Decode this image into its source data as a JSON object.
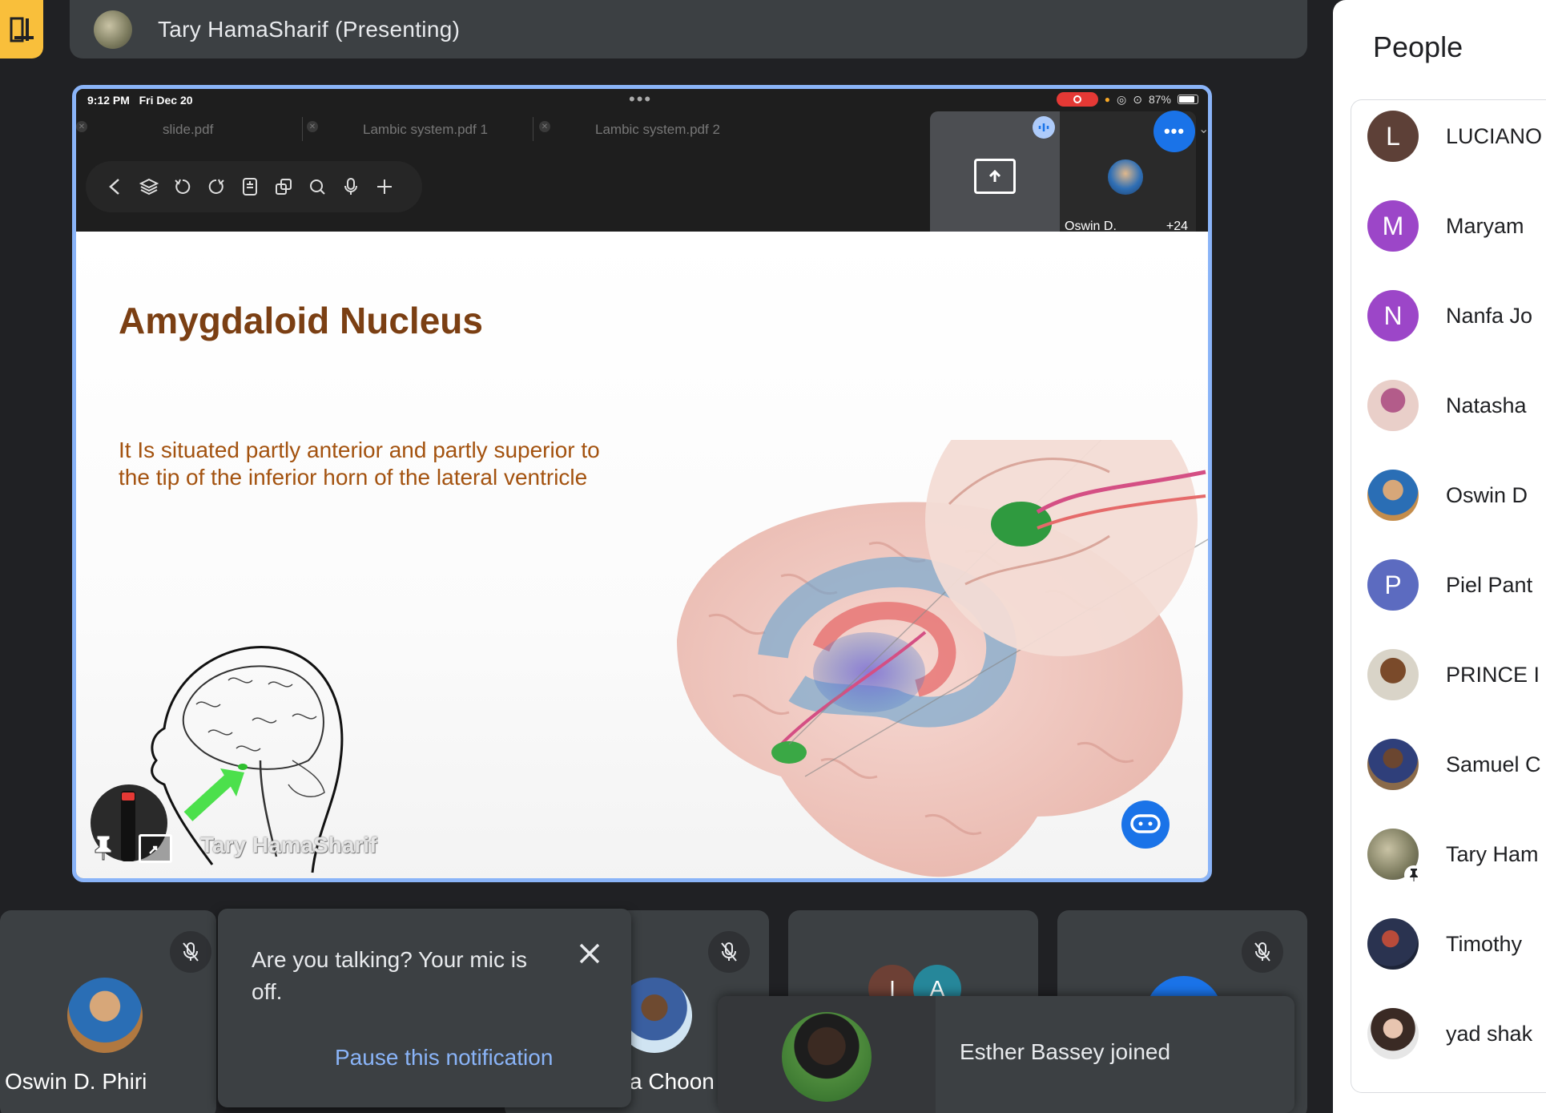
{
  "header": {
    "presenter_title": "Tary HamaSharif (Presenting)"
  },
  "ipad": {
    "time": "9:12 PM",
    "date": "Fri Dec 20",
    "battery": "87%",
    "tabs": [
      {
        "label": "slide.pdf"
      },
      {
        "label": "Lambic system.pdf 1"
      },
      {
        "label": "Lambic system.pdf 2"
      }
    ],
    "mini_tile": {
      "name": "Oswin D.",
      "count": "+24"
    }
  },
  "slide": {
    "title": "Amygdaloid Nucleus",
    "body": "It Is situated partly anterior and partly superior to the tip of the inferior horn of the lateral ventricle",
    "presenter_label": "Tary HamaSharif"
  },
  "tiles": [
    {
      "name": "Oswin D. Phiri"
    },
    {
      "name": "a Choon"
    },
    {
      "initials": [
        "I",
        "A"
      ]
    }
  ],
  "notification": {
    "text": "Are you talking? Your mic is off.",
    "action": "Pause this notification"
  },
  "join_toast": {
    "text": "Esther Bassey joined"
  },
  "people": {
    "title": "People",
    "list": [
      {
        "initial": "L",
        "name": "LUCIANO",
        "color": "#5d4037"
      },
      {
        "initial": "M",
        "name": "Maryam",
        "color": "#9c46c8"
      },
      {
        "initial": "N",
        "name": "Nanfa Jo",
        "color": "#9c46c8"
      },
      {
        "initial": "",
        "name": "Natasha",
        "color": "#c9a6a0"
      },
      {
        "initial": "",
        "name": "Oswin D",
        "color": "#3c6ea8"
      },
      {
        "initial": "P",
        "name": "Piel Pant",
        "color": "#5c6bc0"
      },
      {
        "initial": "",
        "name": "PRINCE I",
        "color": "#6b5a40"
      },
      {
        "initial": "",
        "name": "Samuel C",
        "color": "#5b4a3a"
      },
      {
        "initial": "",
        "name": "Tary Ham",
        "color": "#8c8c6a"
      },
      {
        "initial": "",
        "name": "Timothy",
        "color": "#2c3550"
      },
      {
        "initial": "",
        "name": "yad shak",
        "color": "#6e5a50"
      }
    ]
  }
}
